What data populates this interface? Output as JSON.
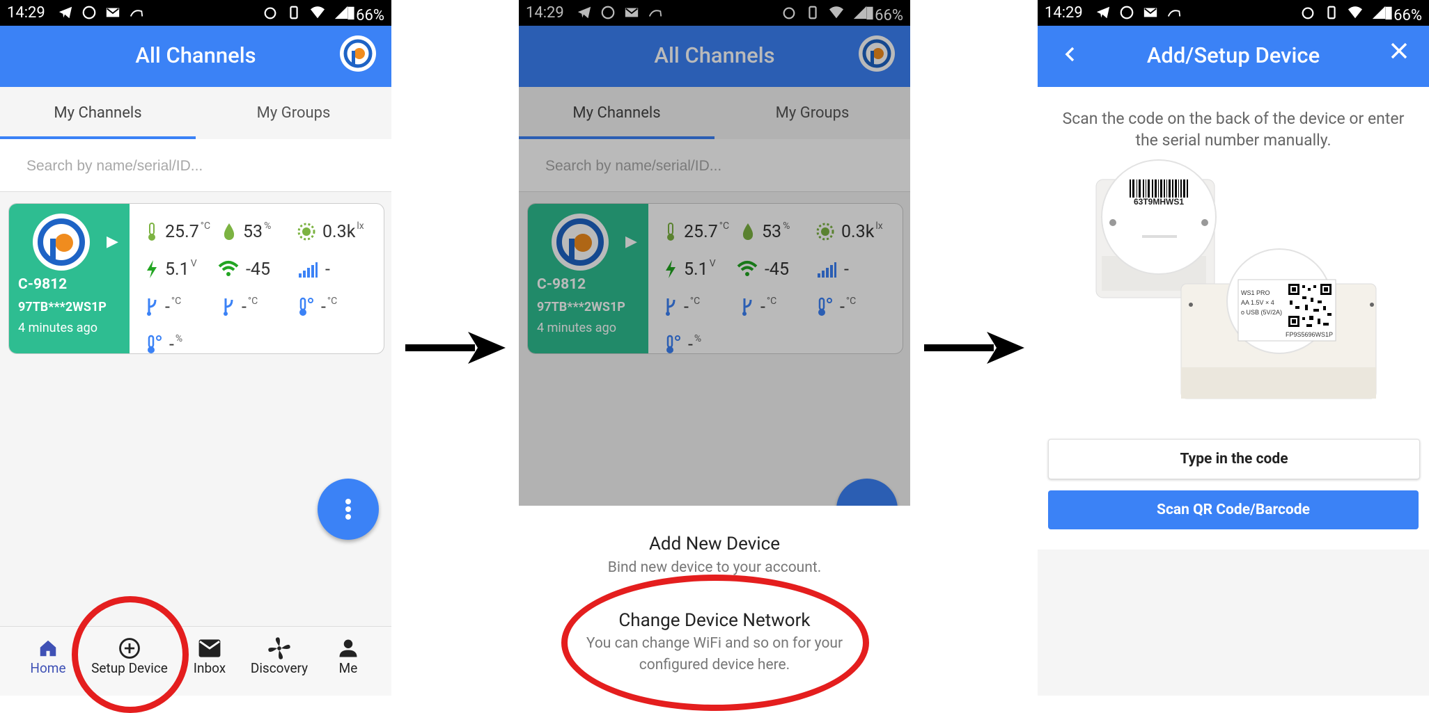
{
  "status_bar": {
    "time": "14:29",
    "battery": "66%"
  },
  "screen1": {
    "title": "All Channels",
    "tabs": [
      "My Channels",
      "My Groups"
    ],
    "search_placeholder": "Search by name/serial/ID...",
    "card": {
      "name": "C-9812",
      "serial": "97TB***2WS1P",
      "last_seen": "4 minutes ago",
      "metrics": [
        {
          "icon": "thermometer-icon",
          "value": "25.7",
          "unit": "°C"
        },
        {
          "icon": "humidity-drop-icon",
          "value": "53",
          "unit": "%"
        },
        {
          "icon": "light-sun-icon",
          "value": "0.3k",
          "unit": "lx"
        },
        {
          "icon": "voltage-bolt-icon",
          "value": "5.1",
          "unit": "V"
        },
        {
          "icon": "wifi-icon",
          "value": "-45",
          "unit": ""
        },
        {
          "icon": "signal-bars-icon",
          "value": "-",
          "unit": ""
        },
        {
          "icon": "probe-icon",
          "value": "-",
          "unit": "°C"
        },
        {
          "icon": "probe-icon",
          "value": "-",
          "unit": "°C"
        },
        {
          "icon": "thermo-probe-icon",
          "value": "-",
          "unit": "°C"
        },
        {
          "icon": "thermo-probe-icon",
          "value": "-",
          "unit": "%"
        }
      ]
    },
    "bottom_nav": [
      "Home",
      "Setup Device",
      "Inbox",
      "Discovery",
      "Me"
    ]
  },
  "screen2": {
    "sheet_items": [
      {
        "title": "Add New Device",
        "description": "Bind new device to your account."
      },
      {
        "title": "Change Device Network",
        "description": "You can change WiFi and so on for your configured device here."
      }
    ]
  },
  "screen3": {
    "title": "Add/Setup Device",
    "instruction": "Scan the code on the back of the device or enter the serial number manually.",
    "barcode_label": "63T9MHWS1",
    "qr_label": "FP9S5696WS1P",
    "device_label_lines": [
      "WS1 PRO",
      "AA 1.5V × 4",
      "o USB (5V/2A)"
    ],
    "type_code_button": "Type in the code",
    "scan_button": "Scan QR Code/Barcode"
  },
  "colors": {
    "primary": "#3b82f6",
    "card_green": "#2ebd91",
    "highlight_ring": "#e41e1e"
  }
}
